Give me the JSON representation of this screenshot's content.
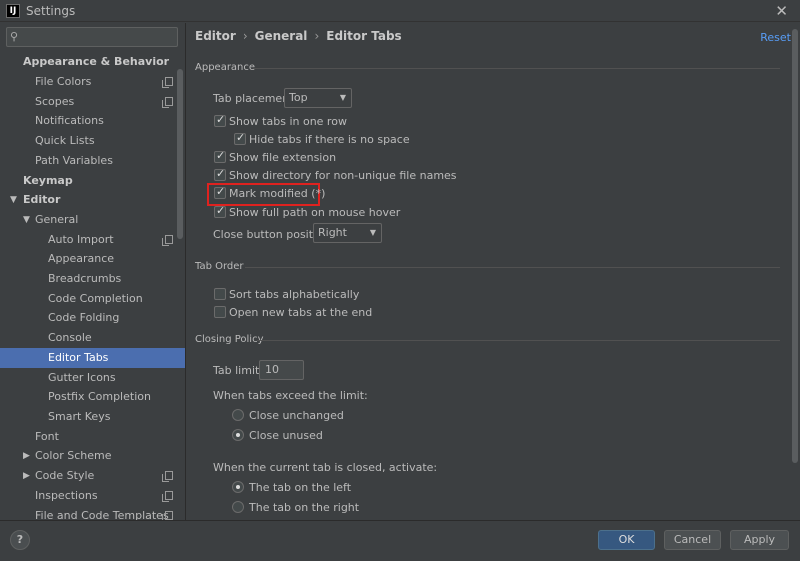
{
  "window": {
    "title": "Settings",
    "icon": "intellij-icon"
  },
  "search": {
    "placeholder": ""
  },
  "sidebar": {
    "items": [
      {
        "label": "Appearance & Behavior"
      },
      {
        "label": "File Colors"
      },
      {
        "label": "Scopes"
      },
      {
        "label": "Notifications"
      },
      {
        "label": "Quick Lists"
      },
      {
        "label": "Path Variables"
      },
      {
        "label": "Keymap"
      },
      {
        "label": "Editor"
      },
      {
        "label": "General"
      },
      {
        "label": "Auto Import"
      },
      {
        "label": "Appearance"
      },
      {
        "label": "Breadcrumbs"
      },
      {
        "label": "Code Completion"
      },
      {
        "label": "Code Folding"
      },
      {
        "label": "Console"
      },
      {
        "label": "Editor Tabs"
      },
      {
        "label": "Gutter Icons"
      },
      {
        "label": "Postfix Completion"
      },
      {
        "label": "Smart Keys"
      },
      {
        "label": "Font"
      },
      {
        "label": "Color Scheme"
      },
      {
        "label": "Code Style"
      },
      {
        "label": "Inspections"
      },
      {
        "label": "File and Code Templates"
      }
    ]
  },
  "breadcrumb": {
    "part1": "Editor",
    "part2": "General",
    "part3": "Editor Tabs"
  },
  "reset_label": "Reset",
  "appearance": {
    "title": "Appearance",
    "tab_placement_label": "Tab placement:",
    "tab_placement_value": "Top",
    "show_tabs_one_row": "Show tabs in one row",
    "hide_tabs_no_space": "Hide tabs if there is no space",
    "show_file_extension": "Show file extension",
    "show_directory": "Show directory for non-unique file names",
    "mark_modified": "Mark modified (*)",
    "show_full_path": "Show full path on mouse hover",
    "close_button_label": "Close button position:",
    "close_button_value": "Right"
  },
  "tab_order": {
    "title": "Tab Order",
    "sort_alpha": "Sort tabs alphabetically",
    "open_at_end": "Open new tabs at the end"
  },
  "closing_policy": {
    "title": "Closing Policy",
    "tab_limit_label": "Tab limit:",
    "tab_limit_value": "10",
    "exceed_label": "When tabs exceed the limit:",
    "close_unchanged": "Close unchanged",
    "close_unused": "Close unused",
    "closed_label": "When the current tab is closed, activate:",
    "tab_left": "The tab on the left",
    "tab_right": "The tab on the right"
  },
  "buttons": {
    "help": "?",
    "ok": "OK",
    "cancel": "Cancel",
    "apply": "Apply"
  },
  "colors": {
    "accent": "#4b6eaf",
    "highlight": "#e0221f",
    "link": "#589df6"
  }
}
